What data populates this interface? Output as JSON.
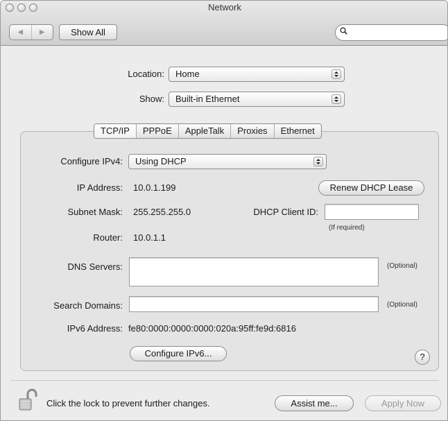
{
  "window": {
    "title": "Network"
  },
  "toolbar": {
    "back_icon": "back-arrow-icon",
    "forward_icon": "forward-arrow-icon",
    "show_all_label": "Show All",
    "search_placeholder": "",
    "search_icon": "magnifier-icon"
  },
  "location": {
    "label": "Location:",
    "value": "Home"
  },
  "show": {
    "label": "Show:",
    "value": "Built-in Ethernet"
  },
  "tabs": [
    {
      "label": "TCP/IP",
      "selected": true
    },
    {
      "label": "PPPoE",
      "selected": false
    },
    {
      "label": "AppleTalk",
      "selected": false
    },
    {
      "label": "Proxies",
      "selected": false
    },
    {
      "label": "Ethernet",
      "selected": false
    }
  ],
  "tcpip": {
    "configure_ipv4_label": "Configure IPv4:",
    "configure_ipv4_value": "Using DHCP",
    "ip_address_label": "IP Address:",
    "ip_address_value": "10.0.1.199",
    "renew_dhcp_label": "Renew DHCP Lease",
    "subnet_mask_label": "Subnet Mask:",
    "subnet_mask_value": "255.255.255.0",
    "dhcp_client_id_label": "DHCP Client ID:",
    "dhcp_client_id_value": "",
    "dhcp_client_id_hint": "(If required)",
    "router_label": "Router:",
    "router_value": "10.0.1.1",
    "dns_servers_label": "DNS Servers:",
    "dns_servers_value": "",
    "dns_optional": "(Optional)",
    "search_domains_label": "Search Domains:",
    "search_domains_value": "",
    "search_domains_optional": "(Optional)",
    "ipv6_address_label": "IPv6 Address:",
    "ipv6_address_value": "fe80:0000:0000:0000:020a:95ff:fe9d:6816",
    "configure_ipv6_label": "Configure IPv6...",
    "help_label": "?"
  },
  "footer": {
    "lock_icon": "padlock-open-icon",
    "lock_text": "Click the lock to prevent further changes.",
    "assist_label": "Assist me...",
    "apply_label": "Apply Now"
  }
}
